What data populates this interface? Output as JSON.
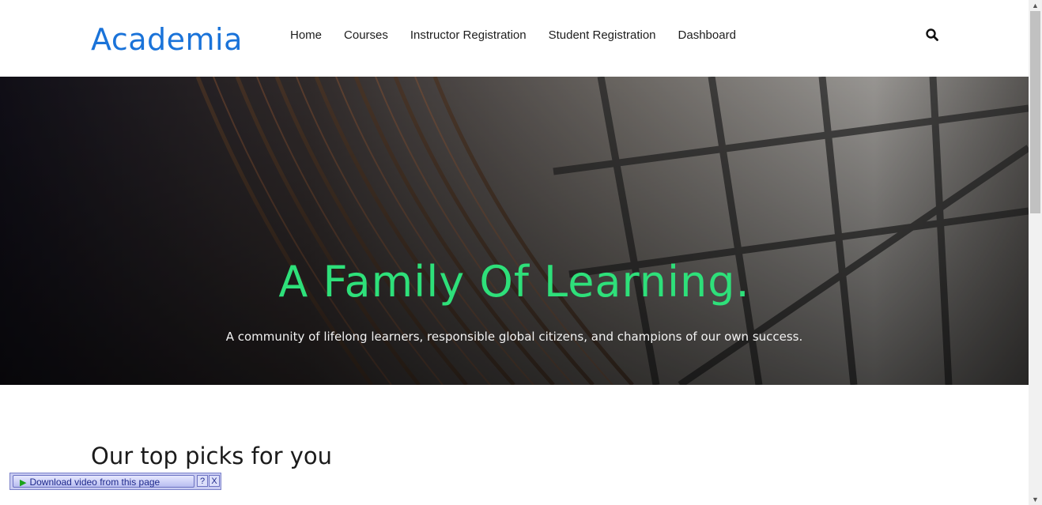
{
  "header": {
    "logo": "Academia",
    "nav": [
      "Home",
      "Courses",
      "Instructor Registration",
      "Student Registration",
      "Dashboard"
    ],
    "search_icon": "search-icon"
  },
  "hero": {
    "title": "A Family Of Learning.",
    "subtitle": "A community of lifelong learners, responsible global citizens, and champions of our own success.",
    "title_color": "#2ee07a"
  },
  "section": {
    "title": "Our top picks for you"
  },
  "download_bar": {
    "label": "Download video from this page",
    "help": "?",
    "close": "X"
  },
  "colors": {
    "brand": "#1a73d9",
    "accent": "#2ee07a"
  }
}
